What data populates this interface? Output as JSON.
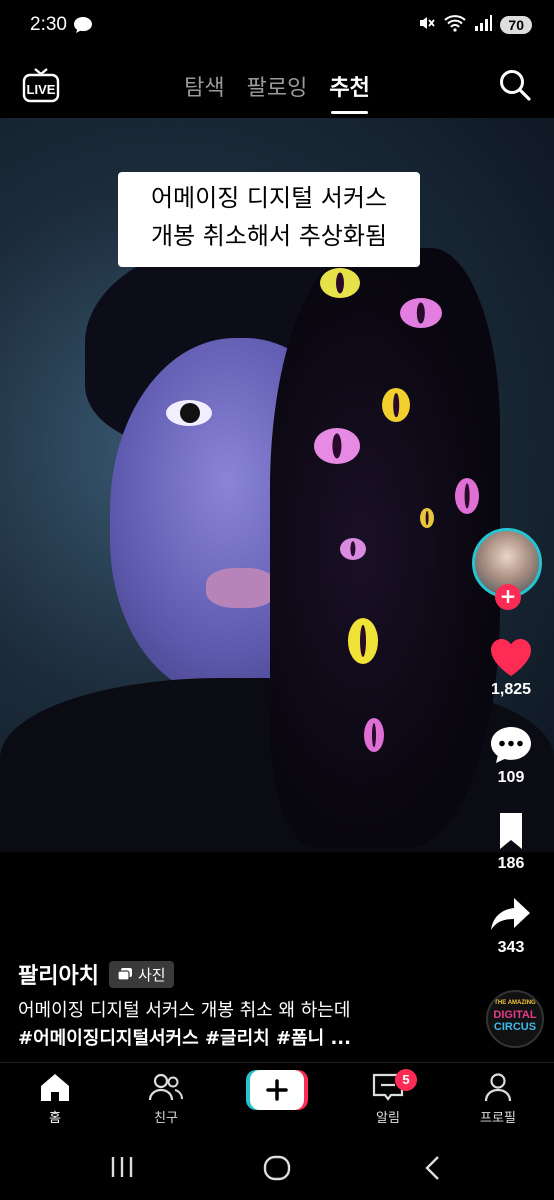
{
  "status_bar": {
    "time": "2:30",
    "battery": "70"
  },
  "top_nav": {
    "live_label": "LIVE",
    "tabs": [
      {
        "label": "탐색",
        "active": false
      },
      {
        "label": "팔로잉",
        "active": false
      },
      {
        "label": "추천",
        "active": true
      }
    ]
  },
  "post": {
    "caption_lines": [
      "어메이징 디지털 서커스",
      "개봉 취소해서 추상화됨"
    ],
    "author": "팔리아치",
    "media_type_badge": "사진",
    "description": "어메이징 디지털 서커스 개봉 취소 왜 하는데",
    "hashtags": "#어메이징디지털서커스 #글리치 #폼니 ..."
  },
  "actions": {
    "likes": "1,825",
    "comments": "109",
    "saves": "186",
    "shares": "343"
  },
  "music_disc": {
    "line1": "THE AMAZING",
    "line2": "DIGITAL",
    "line3": "CIRCUS"
  },
  "bottom_nav": {
    "items": [
      {
        "label": "홈",
        "icon": "home-icon"
      },
      {
        "label": "친구",
        "icon": "friends-icon"
      },
      {
        "label": "",
        "icon": "create-icon"
      },
      {
        "label": "알림",
        "icon": "inbox-icon",
        "badge": "5"
      },
      {
        "label": "프로필",
        "icon": "profile-icon"
      }
    ]
  },
  "colors": {
    "accent": "#fe2c55",
    "cyan": "#25c4d0"
  }
}
